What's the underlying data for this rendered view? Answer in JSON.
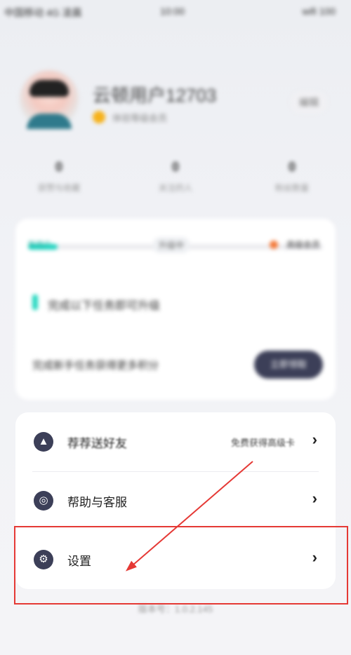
{
  "status_bar": {
    "carrier_text": "中国移动 4G 凌晨",
    "time": "10:00",
    "right_icons": "wifi 100"
  },
  "profile": {
    "name": "云顿用户12703",
    "badge_text": "体验等级会员",
    "edit_label": "编辑"
  },
  "stats": [
    {
      "num": "0",
      "label": "获赞与收藏"
    },
    {
      "num": "0",
      "label": "关注的人"
    },
    {
      "num": "0",
      "label": "粉丝数量"
    }
  ],
  "top_card": {
    "progress_left": "新用户",
    "progress_mid": "升级中",
    "progress_right": "高级会员",
    "progress_fraction": 0.1,
    "tip": "完成以下任务即可升级",
    "bottom_text": "完成新手任务获得更多积分",
    "button_label": "立即领取"
  },
  "menu": {
    "items": [
      {
        "label": "荐荐送好友",
        "extra": "免费获得高级卡",
        "icon": "gift-icon"
      },
      {
        "label": "帮助与客服",
        "extra": "",
        "icon": "headset-icon"
      },
      {
        "label": "设置",
        "extra": "",
        "icon": "gear-icon"
      }
    ]
  },
  "version_text": "版本号：1.0.2.145",
  "annotation": {
    "highlight_color": "#e53935",
    "arrow_color": "#e53935"
  },
  "colors": {
    "accent_dark": "#3c3f58",
    "accent_teal": "#1fd3c0",
    "accent_orange": "#f47a3a"
  }
}
